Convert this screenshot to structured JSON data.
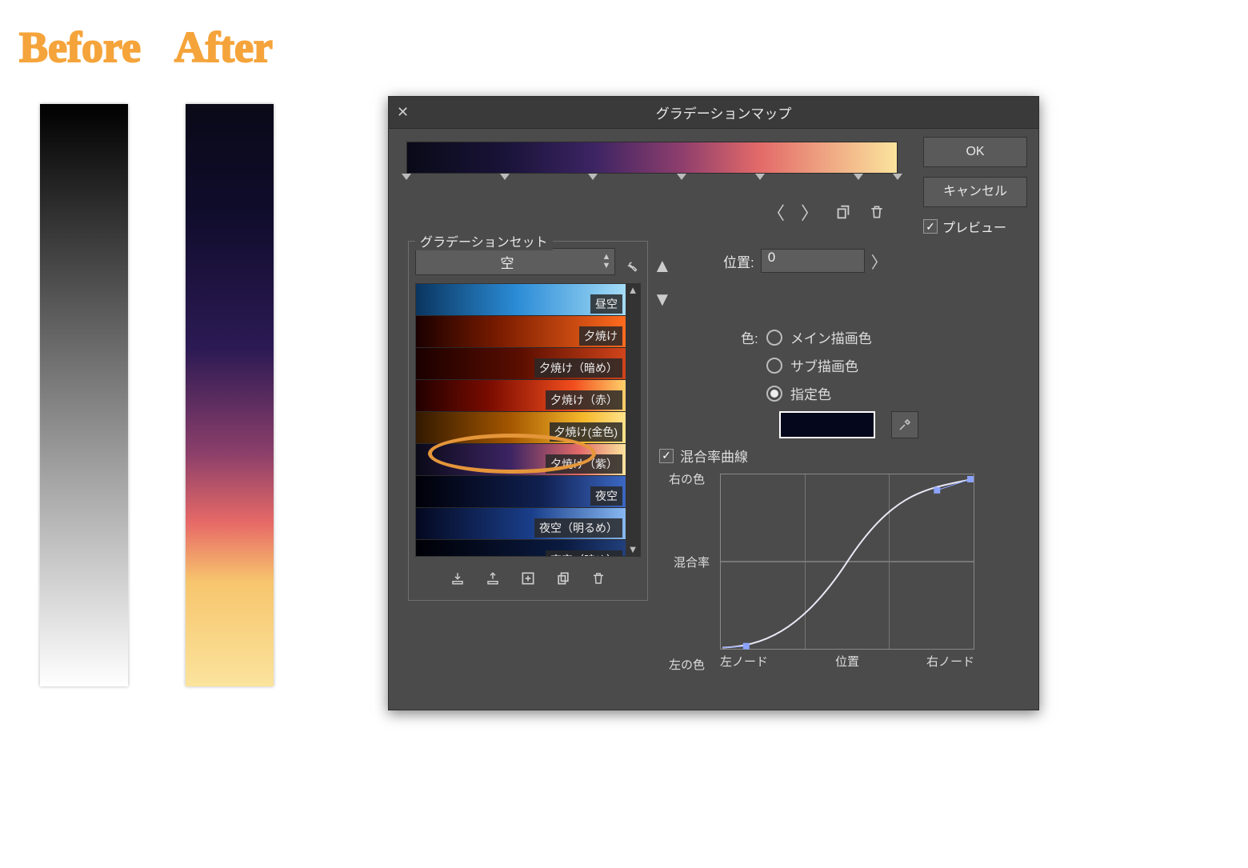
{
  "labels": {
    "before": "Before",
    "after": "After"
  },
  "dialog": {
    "title": "グラデーションマップ",
    "ok": "OK",
    "cancel": "キャンセル",
    "preview": "プレビュー",
    "preview_checked": true
  },
  "gradient_bar": {
    "marker_positions_pct": [
      0,
      20,
      38,
      56,
      72,
      92,
      100
    ]
  },
  "set_panel": {
    "title": "グラデーションセット",
    "dropdown_value": "空",
    "presets": [
      {
        "label": "昼空",
        "css_gradient": "linear-gradient(to right,#0a3560 0%,#2b8cd6 48%,#a4dcf7 100%)"
      },
      {
        "label": "夕焼け",
        "css_gradient": "linear-gradient(to right,#1a0000 0%,#7b1c00 40%,#ff6b1e 100%)"
      },
      {
        "label": "夕焼け（暗め）",
        "css_gradient": "linear-gradient(to right,#1a0000 0%,#5b0e00 50%,#d1441a 100%)"
      },
      {
        "label": "夕焼け（赤）",
        "css_gradient": "linear-gradient(to right,#220000 0%,#7a0c00 35%,#f24d1d 75%,#ffd06a 100%)"
      },
      {
        "label": "夕焼け(金色)",
        "css_gradient": "linear-gradient(to right,#321900 0%,#a45600 45%,#f6b82b 80%,#ffe38a 100%)"
      },
      {
        "label": "夕焼け（紫）",
        "css_gradient": "linear-gradient(to right,#0a0a18 0%,#3c2463 45%,#e36a69 78%,#fbe49d 100%)",
        "highlighted": true
      },
      {
        "label": "夜空",
        "css_gradient": "linear-gradient(to right,#000008 0%,#102050 60%,#3b68c4 100%)"
      },
      {
        "label": "夜空（明るめ）",
        "css_gradient": "linear-gradient(to right,#04081f 0%,#1a3e8a 55%,#87b8f2 100%)"
      },
      {
        "label": "夜空（暗め）",
        "css_gradient": "linear-gradient(to right,#000006 0%,#0a1a40 70%,#22407c 100%)"
      }
    ]
  },
  "position": {
    "label": "位置:",
    "value": "0"
  },
  "color_mode": {
    "label": "色:",
    "options": [
      "メイン描画色",
      "サブ描画色",
      "指定色"
    ],
    "selected_index": 2,
    "swatch_hex": "#05081c"
  },
  "curve": {
    "checkbox_label": "混合率曲線",
    "checked": true,
    "y_labels": [
      "右の色",
      "混合率",
      "左の色"
    ],
    "x_labels": [
      "左ノード",
      "位置",
      "右ノード"
    ],
    "chart_data": {
      "type": "line",
      "x": [
        0,
        0.1,
        0.33,
        0.66,
        0.86,
        1.0
      ],
      "y": [
        0,
        0.02,
        0.18,
        0.72,
        0.92,
        1.0
      ],
      "handles": [
        {
          "x": 0.1,
          "y": 0.02
        },
        {
          "x": 0.86,
          "y": 0.92
        },
        {
          "x": 1.0,
          "y": 1.0
        }
      ],
      "xlabel": "位置",
      "ylabel": "混合率",
      "ylim": [
        0,
        1
      ],
      "xlim": [
        0,
        1
      ]
    }
  },
  "chart_data": {
    "type": "line",
    "title": "混合率曲線",
    "xlabel": "位置",
    "ylabel": "混合率",
    "xlim": [
      0,
      1
    ],
    "ylim": [
      0,
      1
    ],
    "series": [
      {
        "name": "curve",
        "x": [
          0,
          0.1,
          0.33,
          0.66,
          0.86,
          1.0
        ],
        "y": [
          0,
          0.02,
          0.18,
          0.72,
          0.92,
          1.0
        ]
      }
    ]
  }
}
